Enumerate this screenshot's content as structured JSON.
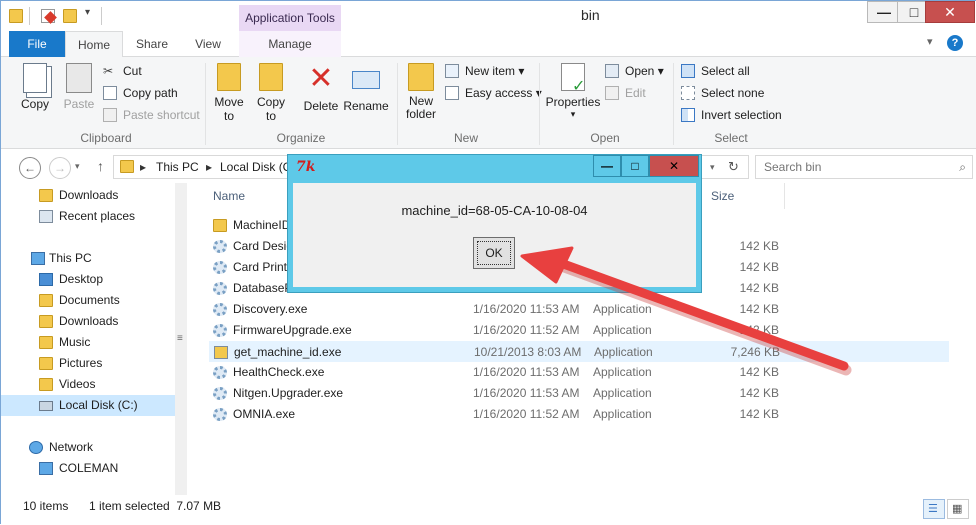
{
  "window": {
    "title": "bin",
    "contextual_tab": "Application Tools"
  },
  "ribbon_tabs": {
    "file": "File",
    "home": "Home",
    "share": "Share",
    "view": "View",
    "manage": "Manage"
  },
  "ribbon": {
    "clipboard": {
      "label": "Clipboard",
      "copy": "Copy",
      "paste": "Paste",
      "cut": "Cut",
      "copy_path": "Copy path",
      "paste_shortcut": "Paste shortcut"
    },
    "organize": {
      "label": "Organize",
      "move_to": "Move to",
      "copy_to": "Copy to",
      "delete": "Delete",
      "rename": "Rename"
    },
    "new": {
      "label": "New",
      "new_folder": "New folder",
      "new_item": "New item",
      "easy_access": "Easy access"
    },
    "open": {
      "label": "Open",
      "properties": "Properties",
      "open": "Open",
      "edit": "Edit"
    },
    "select": {
      "label": "Select",
      "select_all": "Select all",
      "select_none": "Select none",
      "invert_selection": "Invert selection"
    }
  },
  "address": {
    "crumbs": [
      "This PC",
      "Local Disk (C"
    ],
    "search_placeholder": "Search bin"
  },
  "nav_pane": {
    "items": [
      {
        "label": "Downloads",
        "icon": "downloads-folder-icon"
      },
      {
        "label": "Recent places",
        "icon": "recent-places-icon"
      },
      {
        "label": "This PC",
        "icon": "computer-icon"
      },
      {
        "label": "Desktop",
        "icon": "folder-icon"
      },
      {
        "label": "Documents",
        "icon": "folder-icon"
      },
      {
        "label": "Downloads",
        "icon": "folder-icon"
      },
      {
        "label": "Music",
        "icon": "folder-icon"
      },
      {
        "label": "Pictures",
        "icon": "folder-icon"
      },
      {
        "label": "Videos",
        "icon": "folder-icon"
      },
      {
        "label": "Local Disk (C:)",
        "icon": "drive-icon"
      },
      {
        "label": "Network",
        "icon": "network-icon"
      },
      {
        "label": "COLEMAN",
        "icon": "computer-icon"
      }
    ]
  },
  "file_list": {
    "columns": {
      "name": "Name",
      "size": "Size"
    },
    "rows": [
      {
        "name": "MachineID",
        "date": "",
        "type": "",
        "size": "",
        "icon": "folder"
      },
      {
        "name": "Card Desig",
        "date": "",
        "type": "",
        "size": "142 KB",
        "icon": "exe"
      },
      {
        "name": "Card Print",
        "date": "",
        "type": "",
        "size": "142 KB",
        "icon": "exe"
      },
      {
        "name": "DatabaseP",
        "date": "",
        "type": "",
        "size": "142 KB",
        "icon": "exe"
      },
      {
        "name": "Discovery.exe",
        "date": "1/16/2020 11:53 AM",
        "type": "Application",
        "size": "142 KB",
        "icon": "exe"
      },
      {
        "name": "FirmwareUpgrade.exe",
        "date": "1/16/2020 11:52 AM",
        "type": "Application",
        "size": "142 KB",
        "icon": "exe"
      },
      {
        "name": "get_machine_id.exe",
        "date": "10/21/2013 8:03 AM",
        "type": "Application",
        "size": "7,246 KB",
        "icon": "exe-special",
        "selected": true
      },
      {
        "name": "HealthCheck.exe",
        "date": "1/16/2020 11:53 AM",
        "type": "Application",
        "size": "142 KB",
        "icon": "exe"
      },
      {
        "name": "Nitgen.Upgrader.exe",
        "date": "1/16/2020 11:53 AM",
        "type": "Application",
        "size": "142 KB",
        "icon": "exe"
      },
      {
        "name": "OMNIA.exe",
        "date": "1/16/2020 11:52 AM",
        "type": "Application",
        "size": "142 KB",
        "icon": "exe"
      }
    ]
  },
  "status": {
    "items_count": "10 items",
    "selection": "1 item selected  7.07 MB"
  },
  "dialog": {
    "title_glyph": "7k",
    "message": "machine_id=68-05-CA-10-08-04",
    "ok_label": "OK"
  },
  "colors": {
    "accent": "#1979ca",
    "dialog_frame": "#5ec9e8",
    "close_red": "#c7504f",
    "arrow": "#e8403f"
  }
}
